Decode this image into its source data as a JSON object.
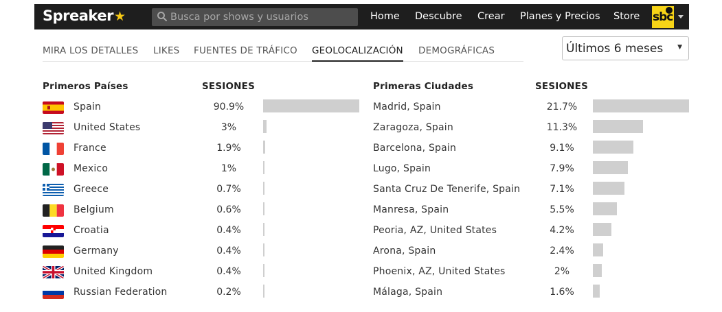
{
  "header": {
    "logo_text": "Spreaker",
    "search_placeholder": "Busca por shows y usuarios",
    "nav": [
      "Home",
      "Descubre",
      "Crear",
      "Planes y Precios",
      "Store"
    ],
    "avatar_text": "sbc"
  },
  "tabs": {
    "items": [
      "MIRA LOS DETALLES",
      "LIKES",
      "FUENTES DE TRÁFICO",
      "GEOLOCALIZACIÓN",
      "DEMOGRÁFICAS"
    ],
    "active": "GEOLOCALIZACIÓN"
  },
  "period": {
    "selected": "Últimos 6 meses"
  },
  "countries": {
    "header": "Primeros Países",
    "sessions_header": "SESIONES",
    "rows": [
      {
        "name": "Spain",
        "value": "90.9%",
        "flag": "es"
      },
      {
        "name": "United States",
        "value": "3%",
        "flag": "us"
      },
      {
        "name": "France",
        "value": "1.9%",
        "flag": "fr"
      },
      {
        "name": "Mexico",
        "value": "1%",
        "flag": "mx"
      },
      {
        "name": "Greece",
        "value": "0.7%",
        "flag": "gr"
      },
      {
        "name": "Belgium",
        "value": "0.6%",
        "flag": "be"
      },
      {
        "name": "Croatia",
        "value": "0.4%",
        "flag": "hr"
      },
      {
        "name": "Germany",
        "value": "0.4%",
        "flag": "de"
      },
      {
        "name": "United Kingdom",
        "value": "0.4%",
        "flag": "gb"
      },
      {
        "name": "Russian Federation",
        "value": "0.2%",
        "flag": "ru"
      }
    ]
  },
  "cities": {
    "header": "Primeras Ciudades",
    "sessions_header": "SESIONES",
    "rows": [
      {
        "name": "Madrid, Spain",
        "value": "21.7%"
      },
      {
        "name": "Zaragoza, Spain",
        "value": "11.3%"
      },
      {
        "name": "Barcelona, Spain",
        "value": "9.1%"
      },
      {
        "name": "Lugo, Spain",
        "value": "7.9%"
      },
      {
        "name": "Santa Cruz De Tenerife, Spain",
        "value": "7.1%"
      },
      {
        "name": "Manresa, Spain",
        "value": "5.5%"
      },
      {
        "name": "Peoria, AZ, United States",
        "value": "4.2%"
      },
      {
        "name": "Arona, Spain",
        "value": "2.4%"
      },
      {
        "name": "Phoenix, AZ, United States",
        "value": "2%"
      },
      {
        "name": "Málaga, Spain",
        "value": "1.6%"
      }
    ]
  },
  "colors": {
    "bar": "#cfcfcf",
    "topbar": "#1e1e1e",
    "logo_star": "#f6c915"
  }
}
